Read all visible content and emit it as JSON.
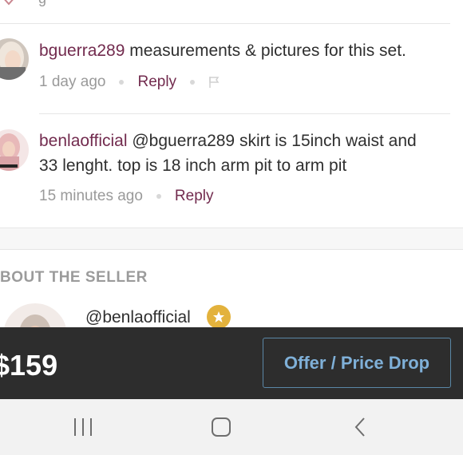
{
  "comments": [
    {
      "username": "bguerra289",
      "text": " measurements & pictures for this set.",
      "time": "1 day ago",
      "reply_label": "Reply"
    },
    {
      "username": "benlaofficial",
      "text_line1_rest": " @bguerra289 skirt is 15inch waist and",
      "text_line2": "33 lenght. top is 18 inch arm pit to arm pit",
      "time": "15 minutes ago",
      "reply_label": "Reply"
    }
  ],
  "about": {
    "heading": "BOUT THE SELLER",
    "handle": "@benlaofficial",
    "badge_icon": "star-icon"
  },
  "bottom_bar": {
    "price": "$159",
    "offer_button": "Offer / Price Drop"
  },
  "nav": {
    "recent": "|||",
    "home": "home-icon",
    "back": "back-icon"
  },
  "colors": {
    "username": "#722b4e",
    "bar": "#2d2d2d",
    "offer": "#7fb0d8",
    "badge": "#e3b23c"
  }
}
